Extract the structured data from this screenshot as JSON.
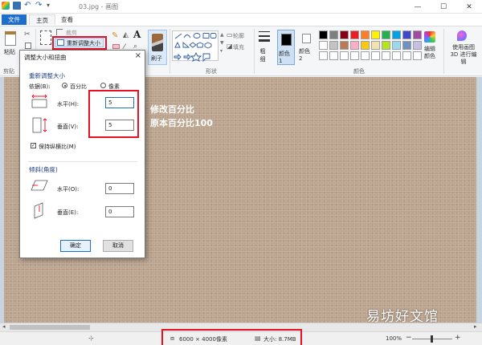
{
  "window": {
    "title": "03.jpg - 画图",
    "minimize": "—",
    "maximize": "☐",
    "close": "✕"
  },
  "tabs": {
    "file": "文件",
    "home": "主页",
    "view": "查看"
  },
  "ribbon": {
    "paste": "粘贴",
    "clipboard": "剪贴",
    "crop": "裁剪",
    "resize": "重新调整大小",
    "brushes": "刷子",
    "outline": "轮廓",
    "fill": "填充",
    "shapes_group": "形状",
    "size": "粗细",
    "color1": "颜色 1",
    "color2": "颜色 2",
    "colors_group": "颜色",
    "edit_colors": "编辑颜色",
    "paint3d": "使用画图 3D 进行编辑"
  },
  "palette": [
    "#000000",
    "#7f7f7f",
    "#880015",
    "#ed1c24",
    "#ff7f27",
    "#fff200",
    "#22b14c",
    "#00a2e8",
    "#3f48cc",
    "#a349a4",
    "#ffffff",
    "#c3c3c3",
    "#b97a57",
    "#ffaec9",
    "#ffc90e",
    "#efe4b0",
    "#b5e61d",
    "#99d9ea",
    "#7092be",
    "#c8bfe7",
    "#ffffff",
    "#ffffff",
    "#ffffff",
    "#ffffff",
    "#ffffff",
    "#ffffff",
    "#ffffff",
    "#ffffff",
    "#ffffff",
    "#ffffff"
  ],
  "canvas": {
    "annotation_line1": "修改百分比",
    "annotation_line2": "原本百分比100"
  },
  "dialog": {
    "title": "调整大小和扭曲",
    "close": "×",
    "resize_heading": "重新调整大小",
    "by_label": "依据(B):",
    "opt_percent": "百分比",
    "opt_pixels": "像素",
    "horizontal_label": "水平(H):",
    "horizontal_value": "5",
    "vertical_label": "垂直(V):",
    "vertical_value": "5",
    "keep_ratio": "保持纵横比(M)",
    "skew_heading": "倾斜(角度)",
    "skew_h_label": "水平(O):",
    "skew_h_value": "0",
    "skew_v_label": "垂直(E):",
    "skew_v_value": "0",
    "ok": "确定",
    "cancel": "取消"
  },
  "status": {
    "dimensions": "6000 × 4000像素",
    "size": "大小: 8.7MB",
    "zoom": "100%",
    "zoom_out": "−",
    "zoom_in": "+"
  },
  "watermark": "易坊好文馆",
  "colors": {
    "accent": "#1e6fcb",
    "highlight": "#e81123",
    "canvas": "#bba38d"
  }
}
